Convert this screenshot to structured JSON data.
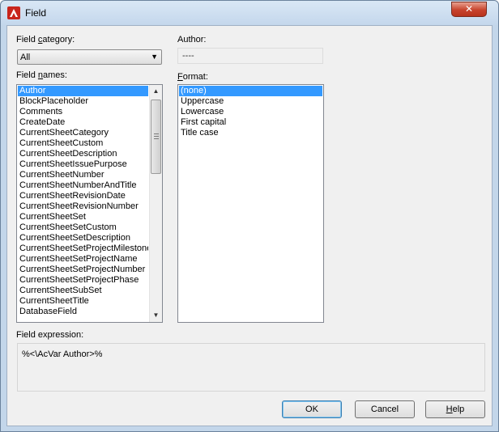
{
  "window": {
    "title": "Field",
    "close_glyph": "✕"
  },
  "field_category": {
    "label_pre": "Field ",
    "label_accel": "c",
    "label_post": "ategory:",
    "selected": "All"
  },
  "author": {
    "label": "Author:",
    "value": "----"
  },
  "field_names": {
    "label_pre": "Field ",
    "label_accel": "n",
    "label_post": "ames:",
    "items": [
      "Author",
      "BlockPlaceholder",
      "Comments",
      "CreateDate",
      "CurrentSheetCategory",
      "CurrentSheetCustom",
      "CurrentSheetDescription",
      "CurrentSheetIssuePurpose",
      "CurrentSheetNumber",
      "CurrentSheetNumberAndTitle",
      "CurrentSheetRevisionDate",
      "CurrentSheetRevisionNumber",
      "CurrentSheetSet",
      "CurrentSheetSetCustom",
      "CurrentSheetSetDescription",
      "CurrentSheetSetProjectMilestone",
      "CurrentSheetSetProjectName",
      "CurrentSheetSetProjectNumber",
      "CurrentSheetSetProjectPhase",
      "CurrentSheetSubSet",
      "CurrentSheetTitle",
      "DatabaseField"
    ],
    "selected_index": 0
  },
  "format": {
    "label_accel": "F",
    "label_post": "ormat:",
    "items": [
      "(none)",
      "Uppercase",
      "Lowercase",
      "First capital",
      "Title case"
    ],
    "selected_index": 0
  },
  "expression": {
    "label": "Field expression:",
    "value": "%<\\AcVar Author>%"
  },
  "buttons": {
    "ok": "OK",
    "cancel": "Cancel",
    "help_accel": "H",
    "help_post": "elp"
  },
  "colors": {
    "selection": "#3399ff",
    "titlebar": "#c4d7ec",
    "close_button": "#c7432c",
    "dialog_bg": "#f0f0f0"
  }
}
